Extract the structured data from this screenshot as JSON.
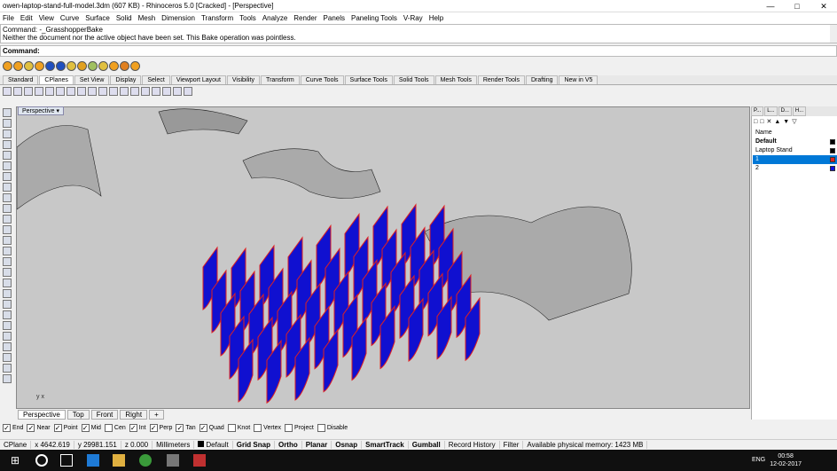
{
  "window": {
    "title": "owen-laptop-stand-full-model.3dm (607 KB) - Rhinoceros 5.0 [Cracked] - [Perspective]"
  },
  "menu": [
    "File",
    "Edit",
    "View",
    "Curve",
    "Surface",
    "Solid",
    "Mesh",
    "Dimension",
    "Transform",
    "Tools",
    "Analyze",
    "Render",
    "Panels",
    "Paneling Tools",
    "V-Ray",
    "Help"
  ],
  "command": {
    "history_1": "Command: -_GrasshopperBake",
    "history_2": "Neither the document nor the active object have been set. This Bake operation was pointless.",
    "prompt": "Command:"
  },
  "tabs": [
    "Standard",
    "CPlanes",
    "Set View",
    "Display",
    "Select",
    "Viewport Layout",
    "Visibility",
    "Transform",
    "Curve Tools",
    "Surface Tools",
    "Solid Tools",
    "Mesh Tools",
    "Render Tools",
    "Drafting",
    "New in V5"
  ],
  "active_tab": "CPlanes",
  "viewport": {
    "label": "Perspective",
    "tabs": [
      "Perspective",
      "Top",
      "Front",
      "Right",
      "+"
    ]
  },
  "osnap": [
    "End",
    "Near",
    "Point",
    "Mid",
    "Cen",
    "Int",
    "Perp",
    "Tan",
    "Quad",
    "Knot",
    "Vertex",
    "Project",
    "Disable"
  ],
  "osnap_checked": [
    "End",
    "Near",
    "Point",
    "Mid",
    "Int",
    "Perp",
    "Tan",
    "Quad"
  ],
  "status": {
    "cplane": "CPlane",
    "x": "x 4642.619",
    "y": "y 29981.151",
    "z": "z 0.000",
    "units": "Millimeters",
    "layer": "Default",
    "grid": "Grid Snap",
    "ortho": "Ortho",
    "planar": "Planar",
    "osnap": "Osnap",
    "smart": "SmartTrack",
    "gumball": "Gumball",
    "record": "Record History",
    "filter": "Filter",
    "memory": "Available physical memory: 1423 MB"
  },
  "panel": {
    "tabs": [
      "P...",
      "L...",
      "D...",
      "H..."
    ],
    "header": "Name",
    "layers": [
      {
        "name": "Default",
        "bold": true,
        "color": "#000000"
      },
      {
        "name": "Laptop Stand",
        "color": "#000000"
      },
      {
        "name": "1",
        "selected": true,
        "color": "#e02020"
      },
      {
        "name": "2",
        "color": "#1010e0"
      }
    ]
  },
  "taskbar": {
    "lang": "ENG",
    "time": "00:58",
    "date": "12-02-2017"
  },
  "colors": {
    "red": "#e02020",
    "blue": "#1010d0"
  }
}
